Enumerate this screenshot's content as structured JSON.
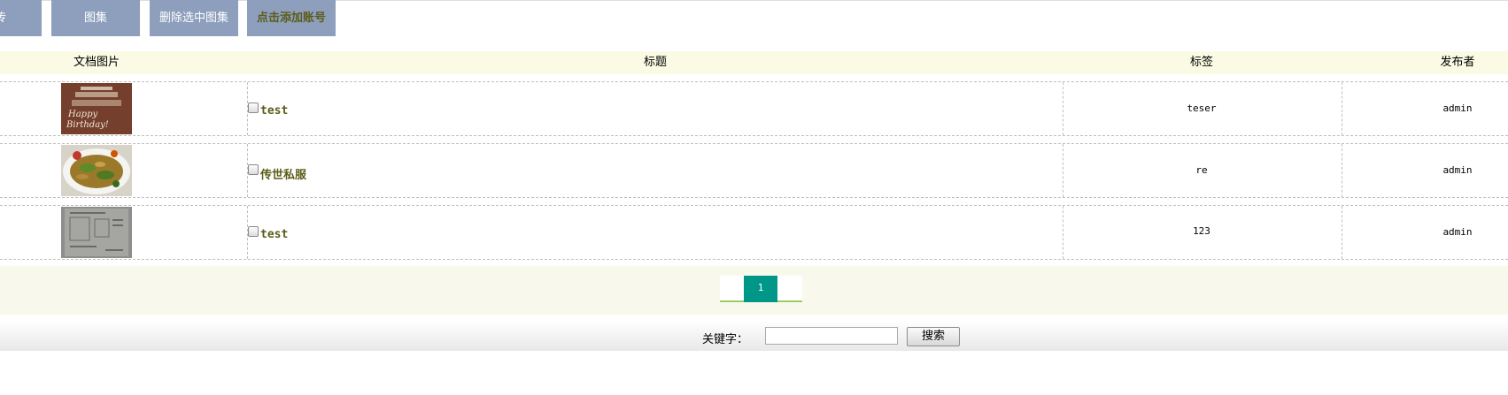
{
  "toolbar": {
    "upload_label": "传",
    "album_label": "图集",
    "delete_label": "删除选中图集",
    "add_account_label": "点击添加账号"
  },
  "table": {
    "columns": [
      "文档图片",
      "标题",
      "标签",
      "发布者"
    ],
    "rows": [
      {
        "thumbnail": "birthday-cake-photo",
        "title": "test",
        "tag": "teser",
        "publisher": "admin"
      },
      {
        "thumbnail": "stir-fry-dish-photo",
        "title": "传世私服",
        "tag": "re",
        "publisher": "admin"
      },
      {
        "thumbnail": "document-scan-photo",
        "title": "test",
        "tag": "123",
        "publisher": "admin"
      }
    ]
  },
  "pagination": {
    "current_page": "1"
  },
  "search": {
    "label": "关键字：",
    "value": "",
    "button_label": "搜索"
  },
  "colors": {
    "toolbar_button": "#8d9fbd",
    "header_background": "#fbfbe5",
    "title_link": "#5c5c1a",
    "active_page": "#009688"
  }
}
